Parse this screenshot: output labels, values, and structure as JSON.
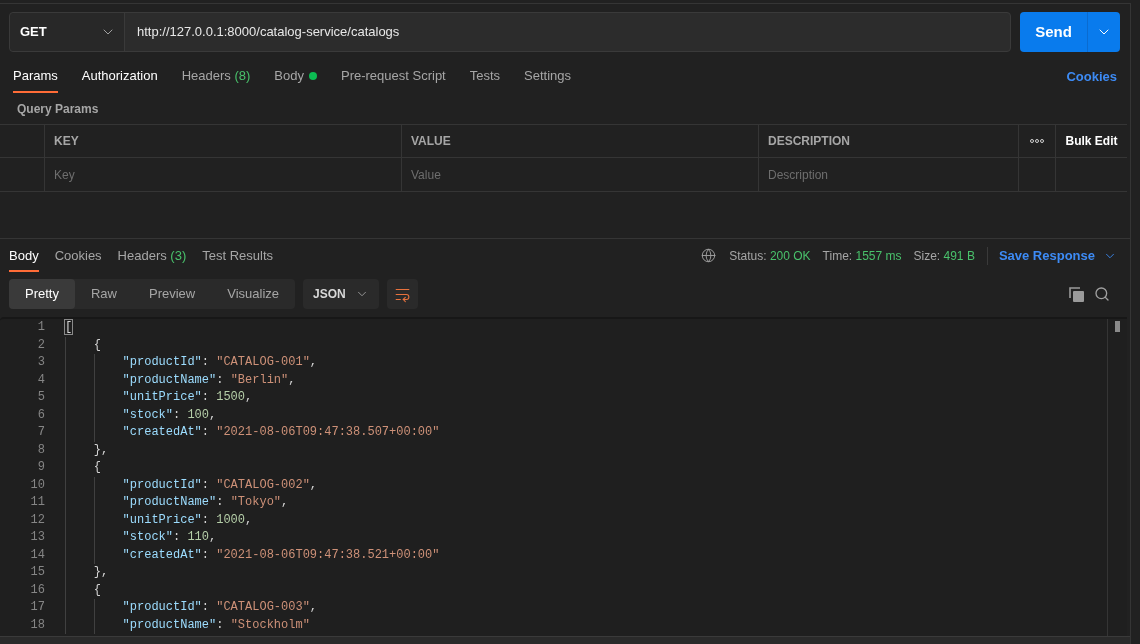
{
  "request": {
    "method": "GET",
    "url": "http://127.0.0.1:8000/catalog-service/catalogs",
    "send_label": "Send"
  },
  "request_tabs": [
    {
      "label": "Params",
      "selected": true,
      "highlighted": true,
      "dot": false
    },
    {
      "label": "Authorization",
      "selected": false,
      "highlighted": true,
      "dot": false
    },
    {
      "label": "Headers",
      "count": "(8)",
      "selected": false,
      "highlighted": false,
      "dot": false
    },
    {
      "label": "Body",
      "selected": false,
      "highlighted": false,
      "dot": true
    },
    {
      "label": "Pre-request Script",
      "selected": false,
      "highlighted": false,
      "dot": false
    },
    {
      "label": "Tests",
      "selected": false,
      "highlighted": false,
      "dot": false
    },
    {
      "label": "Settings",
      "selected": false,
      "highlighted": false,
      "dot": false
    }
  ],
  "cookies_link": "Cookies",
  "query_params": {
    "title": "Query Params",
    "columns": [
      "KEY",
      "VALUE",
      "DESCRIPTION"
    ],
    "bulk_edit": "Bulk Edit",
    "placeholders": [
      "Key",
      "Value",
      "Description"
    ]
  },
  "response_tabs": [
    {
      "label": "Body",
      "selected": true
    },
    {
      "label": "Cookies",
      "selected": false
    },
    {
      "label": "Headers",
      "count": "(3)",
      "selected": false
    },
    {
      "label": "Test Results",
      "selected": false
    }
  ],
  "response_meta": [
    {
      "label": "Status:",
      "value": "200 OK"
    },
    {
      "label": "Time:",
      "value": "1557 ms"
    },
    {
      "label": "Size:",
      "value": "491 B"
    }
  ],
  "save_response": "Save Response",
  "view_modes": [
    {
      "label": "Pretty",
      "selected": true
    },
    {
      "label": "Raw",
      "selected": false
    },
    {
      "label": "Preview",
      "selected": false
    },
    {
      "label": "Visualize",
      "selected": false
    }
  ],
  "format": "JSON",
  "wrap_lines": {
    "on": true
  },
  "code_lines": [
    {
      "number": "1",
      "bracket_highlighted": true,
      "tokens": [
        {
          "kind": "punct",
          "text": "["
        }
      ],
      "children": [
        {
          "number": "2",
          "bracket_highlighted": false,
          "tokens": [
            {
              "kind": "punct",
              "text": "{"
            }
          ],
          "children": [
            {
              "number": "3",
              "bracket_highlighted": false,
              "tokens": [
                {
                  "kind": "key",
                  "text": "\"productId\""
                },
                {
                  "kind": "punct",
                  "text": ": "
                },
                {
                  "kind": "string",
                  "text": "\"CATALOG-001\""
                },
                {
                  "kind": "punct",
                  "text": ","
                }
              ]
            },
            {
              "number": "4",
              "bracket_highlighted": false,
              "tokens": [
                {
                  "kind": "key",
                  "text": "\"productName\""
                },
                {
                  "kind": "punct",
                  "text": ": "
                },
                {
                  "kind": "string",
                  "text": "\"Berlin\""
                },
                {
                  "kind": "punct",
                  "text": ","
                }
              ]
            },
            {
              "number": "5",
              "bracket_highlighted": false,
              "tokens": [
                {
                  "kind": "key",
                  "text": "\"unitPrice\""
                },
                {
                  "kind": "punct",
                  "text": ": "
                },
                {
                  "kind": "number",
                  "text": "1500"
                },
                {
                  "kind": "punct",
                  "text": ","
                }
              ]
            },
            {
              "number": "6",
              "bracket_highlighted": false,
              "tokens": [
                {
                  "kind": "key",
                  "text": "\"stock\""
                },
                {
                  "kind": "punct",
                  "text": ": "
                },
                {
                  "kind": "number",
                  "text": "100"
                },
                {
                  "kind": "punct",
                  "text": ","
                }
              ]
            },
            {
              "number": "7",
              "bracket_highlighted": false,
              "tokens": [
                {
                  "kind": "key",
                  "text": "\"createdAt\""
                },
                {
                  "kind": "punct",
                  "text": ": "
                },
                {
                  "kind": "string",
                  "text": "\"2021-08-06T09:47:38.507+00:00\""
                }
              ]
            }
          ]
        },
        {
          "number": "8",
          "bracket_highlighted": false,
          "tokens": [
            {
              "kind": "punct",
              "text": "},"
            }
          ]
        },
        {
          "number": "9",
          "bracket_highlighted": false,
          "tokens": [
            {
              "kind": "punct",
              "text": "{"
            }
          ],
          "children": [
            {
              "number": "10",
              "bracket_highlighted": false,
              "tokens": [
                {
                  "kind": "key",
                  "text": "\"productId\""
                },
                {
                  "kind": "punct",
                  "text": ": "
                },
                {
                  "kind": "string",
                  "text": "\"CATALOG-002\""
                },
                {
                  "kind": "punct",
                  "text": ","
                }
              ]
            },
            {
              "number": "11",
              "bracket_highlighted": false,
              "tokens": [
                {
                  "kind": "key",
                  "text": "\"productName\""
                },
                {
                  "kind": "punct",
                  "text": ": "
                },
                {
                  "kind": "string",
                  "text": "\"Tokyo\""
                },
                {
                  "kind": "punct",
                  "text": ","
                }
              ]
            },
            {
              "number": "12",
              "bracket_highlighted": false,
              "tokens": [
                {
                  "kind": "key",
                  "text": "\"unitPrice\""
                },
                {
                  "kind": "punct",
                  "text": ": "
                },
                {
                  "kind": "number",
                  "text": "1000"
                },
                {
                  "kind": "punct",
                  "text": ","
                }
              ]
            },
            {
              "number": "13",
              "bracket_highlighted": false,
              "tokens": [
                {
                  "kind": "key",
                  "text": "\"stock\""
                },
                {
                  "kind": "punct",
                  "text": ": "
                },
                {
                  "kind": "number",
                  "text": "110"
                },
                {
                  "kind": "punct",
                  "text": ","
                }
              ]
            },
            {
              "number": "14",
              "bracket_highlighted": false,
              "tokens": [
                {
                  "kind": "key",
                  "text": "\"createdAt\""
                },
                {
                  "kind": "punct",
                  "text": ": "
                },
                {
                  "kind": "string",
                  "text": "\"2021-08-06T09:47:38.521+00:00\""
                }
              ]
            }
          ]
        },
        {
          "number": "15",
          "bracket_highlighted": false,
          "tokens": [
            {
              "kind": "punct",
              "text": "},"
            }
          ]
        },
        {
          "number": "16",
          "bracket_highlighted": false,
          "tokens": [
            {
              "kind": "punct",
              "text": "{"
            }
          ],
          "children": [
            {
              "number": "17",
              "bracket_highlighted": false,
              "tokens": [
                {
                  "kind": "key",
                  "text": "\"productId\""
                },
                {
                  "kind": "punct",
                  "text": ": "
                },
                {
                  "kind": "string",
                  "text": "\"CATALOG-003\""
                },
                {
                  "kind": "punct",
                  "text": ","
                }
              ]
            },
            {
              "number": "18",
              "bracket_highlighted": false,
              "tokens": [
                {
                  "kind": "key",
                  "text": "\"productName\""
                },
                {
                  "kind": "punct",
                  "text": ": "
                },
                {
                  "kind": "string",
                  "text": "\"Stockholm\""
                }
              ]
            }
          ]
        }
      ]
    }
  ]
}
